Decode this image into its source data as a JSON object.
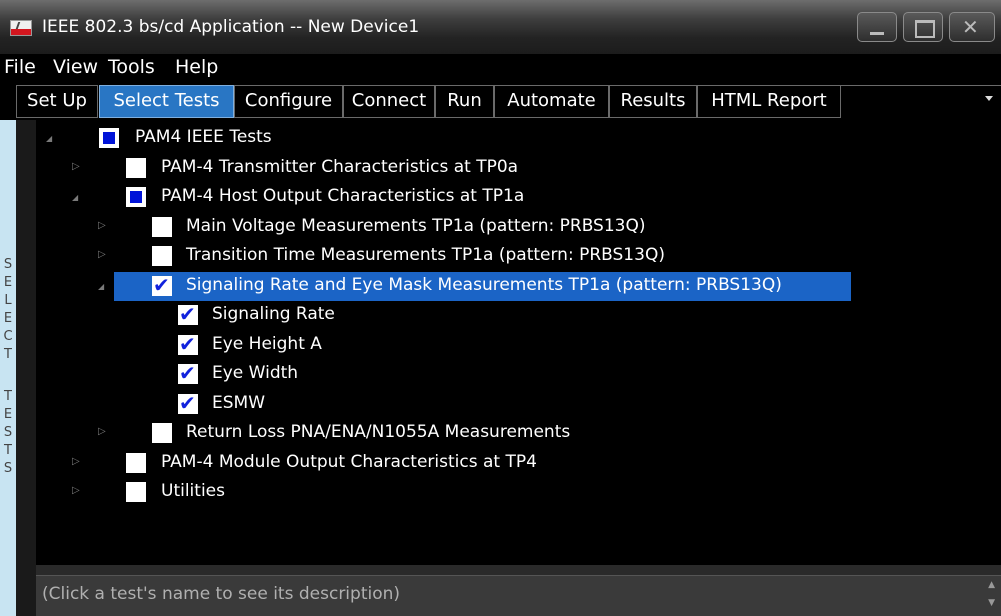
{
  "window": {
    "title": "IEEE 802.3 bs/cd Application -- New Device1"
  },
  "menu": [
    "File",
    "View",
    "Tools",
    "Help"
  ],
  "tabs": [
    "Set Up",
    "Select Tests",
    "Configure",
    "Connect",
    "Run",
    "Automate",
    "Results",
    "HTML Report"
  ],
  "active_tab": "Select Tests",
  "sidebar_label": "SELECT TESTS",
  "tree": [
    {
      "label": "PAM4 IEEE Tests",
      "state": "partial",
      "expanded": true,
      "level": 0
    },
    {
      "label": "PAM-4 Transmitter Characteristics at TP0a",
      "state": "unchecked",
      "expanded": false,
      "level": 1
    },
    {
      "label": "PAM-4 Host Output Characteristics at TP1a",
      "state": "partial",
      "expanded": true,
      "level": 1
    },
    {
      "label": "Main Voltage Measurements TP1a (pattern: PRBS13Q)",
      "state": "unchecked",
      "expanded": false,
      "level": 2
    },
    {
      "label": "Transition Time Measurements TP1a (pattern: PRBS13Q)",
      "state": "unchecked",
      "expanded": false,
      "level": 2
    },
    {
      "label": "Signaling Rate and Eye Mask Measurements TP1a (pattern: PRBS13Q)",
      "state": "checked",
      "expanded": true,
      "level": 2,
      "selected": true
    },
    {
      "label": "Signaling Rate",
      "state": "checked",
      "level": 3
    },
    {
      "label": "Eye Height A",
      "state": "checked",
      "level": 3
    },
    {
      "label": "Eye Width",
      "state": "checked",
      "level": 3
    },
    {
      "label": "ESMW",
      "state": "checked",
      "level": 3
    },
    {
      "label": "Return Loss PNA/ENA/N1055A Measurements",
      "state": "unchecked",
      "expanded": false,
      "level": 2
    },
    {
      "label": "PAM-4 Module Output Characteristics at TP4",
      "state": "unchecked",
      "expanded": false,
      "level": 1
    },
    {
      "label": "Utilities",
      "state": "unchecked",
      "expanded": false,
      "level": 1
    }
  ],
  "description": "(Click a test's name to see its description)",
  "colors": {
    "selection": "#1b64c6",
    "active_tab": "#2976c4",
    "partial_fill": "#0013d8",
    "sidebar": "#c8e4f2"
  }
}
